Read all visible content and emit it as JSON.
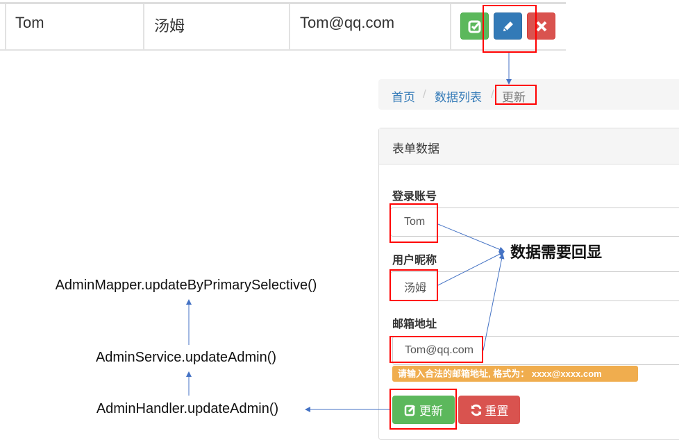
{
  "table_row": {
    "username": "Tom",
    "nickname": "汤姆",
    "email": "Tom@qq.com",
    "actions": [
      {
        "icon": "check-square-icon",
        "color": "#5cb85c"
      },
      {
        "icon": "pencil-icon",
        "color": "#337ab7"
      },
      {
        "icon": "close-icon",
        "color": "#d9534f"
      }
    ]
  },
  "breadcrumb": {
    "items": [
      "首页",
      "数据列表"
    ],
    "separator": "/",
    "current": "更新"
  },
  "panel": {
    "title": "表单数据"
  },
  "form": {
    "username_label": "登录账号",
    "username_value": "Tom",
    "nickname_label": "用户昵称",
    "nickname_value": "汤姆",
    "email_label": "邮箱地址",
    "email_value": "Tom@qq.com",
    "email_hint": "请输入合法的邮箱地址, 格式为： xxxx@xxxx.com",
    "submit_label": "更新",
    "reset_label": "重置"
  },
  "annotations": {
    "echo_note": "数据需要回显",
    "call_chain": [
      "AdminMapper.updateByPrimarySelective()",
      "AdminService.updateAdmin()",
      "AdminHandler.updateAdmin()"
    ]
  },
  "colors": {
    "highlight": "#ff0000",
    "arrow": "#4472c4",
    "hint": "#f0ad4e",
    "link": "#337ab7"
  }
}
